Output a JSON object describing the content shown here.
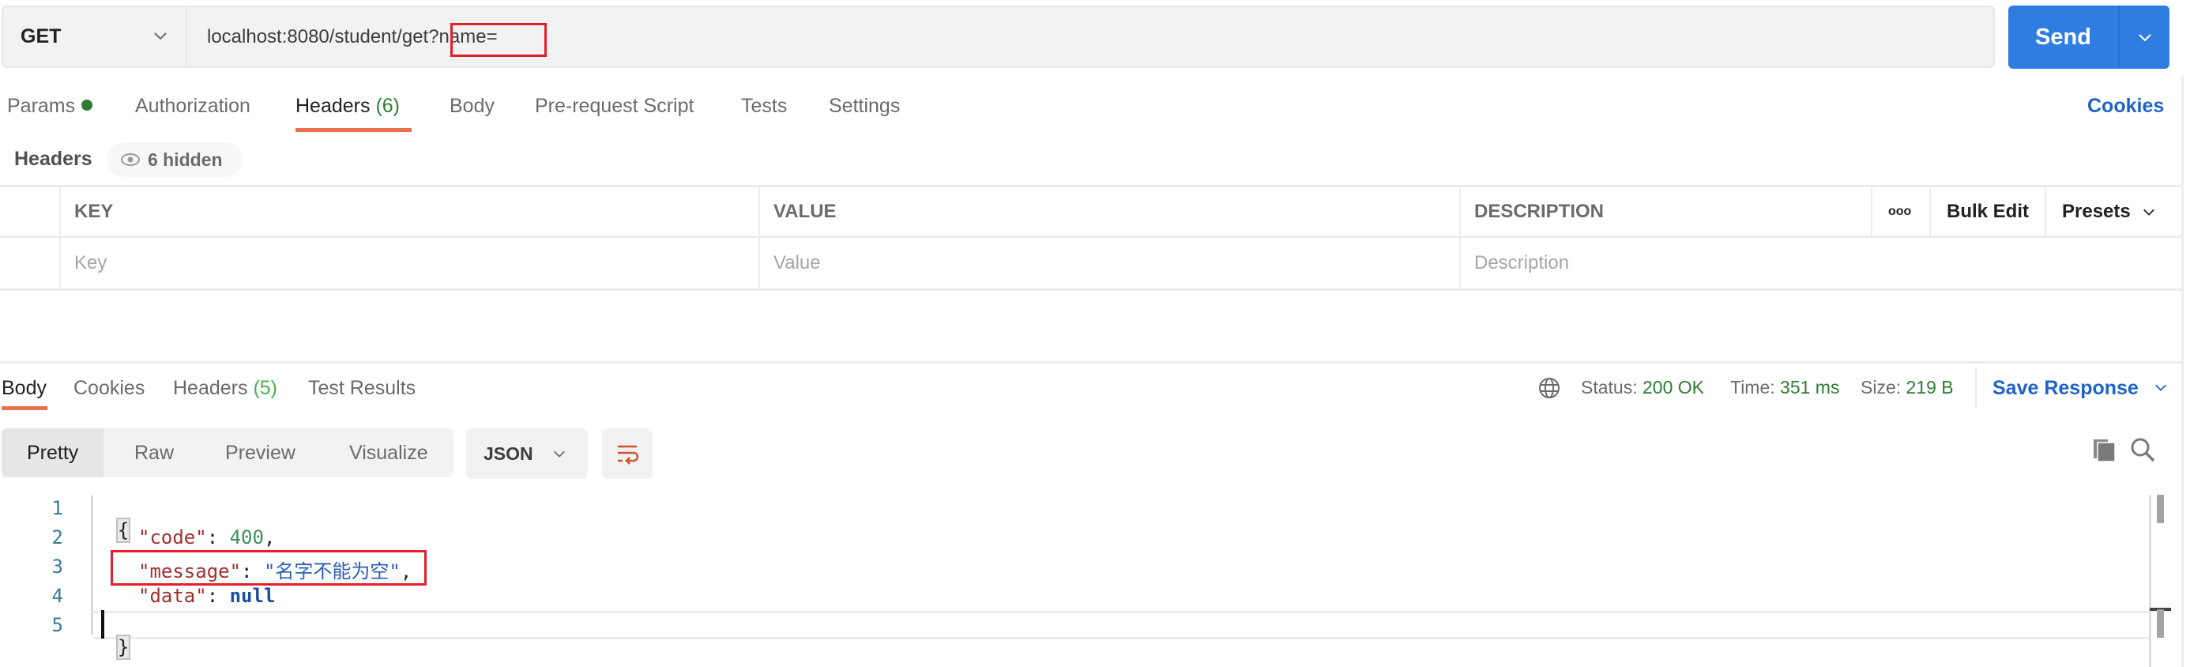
{
  "request": {
    "method": "GET",
    "url": "localhost:8080/student/get?name=",
    "send_label": "Send"
  },
  "request_tabs": [
    {
      "label": "Params",
      "has_dot": true
    },
    {
      "label": "Authorization"
    },
    {
      "label": "Headers",
      "count": "(6)",
      "active": true
    },
    {
      "label": "Body"
    },
    {
      "label": "Pre-request Script"
    },
    {
      "label": "Tests"
    },
    {
      "label": "Settings"
    }
  ],
  "cookies_link": "Cookies",
  "headers_section": {
    "label": "Headers",
    "hidden_badge": "6 hidden",
    "columns": [
      "KEY",
      "VALUE",
      "DESCRIPTION"
    ],
    "tools": {
      "more": "ooo",
      "bulk_edit": "Bulk Edit",
      "presets": "Presets"
    },
    "placeholders": {
      "key": "Key",
      "value": "Value",
      "description": "Description"
    }
  },
  "response_tabs": [
    {
      "label": "Body",
      "active": true
    },
    {
      "label": "Cookies"
    },
    {
      "label": "Headers",
      "count": "(5)"
    },
    {
      "label": "Test Results"
    }
  ],
  "response_meta": {
    "status_label": "Status:",
    "status_value": "200 OK",
    "time_label": "Time:",
    "time_value": "351 ms",
    "size_label": "Size:",
    "size_value": "219 B",
    "save_response": "Save Response"
  },
  "view_modes": [
    "Pretty",
    "Raw",
    "Preview",
    "Visualize"
  ],
  "active_view_mode": "Pretty",
  "format": "JSON",
  "code_lines": [
    {
      "num": "1",
      "text": "{"
    },
    {
      "num": "2",
      "key": "\"code\"",
      "value": "400",
      "trail": ","
    },
    {
      "num": "3",
      "key": "\"message\"",
      "value": "\"名字不能为空\"",
      "trail": ","
    },
    {
      "num": "4",
      "key": "\"data\"",
      "value": "null",
      "trail": ""
    },
    {
      "num": "5",
      "text": "}"
    }
  ],
  "colors": {
    "accent_blue": "#2f7de1",
    "link_blue": "#2063c8",
    "tab_underline": "#e9724c",
    "status_green": "#2e7d32",
    "highlight_red": "#e0202a"
  }
}
